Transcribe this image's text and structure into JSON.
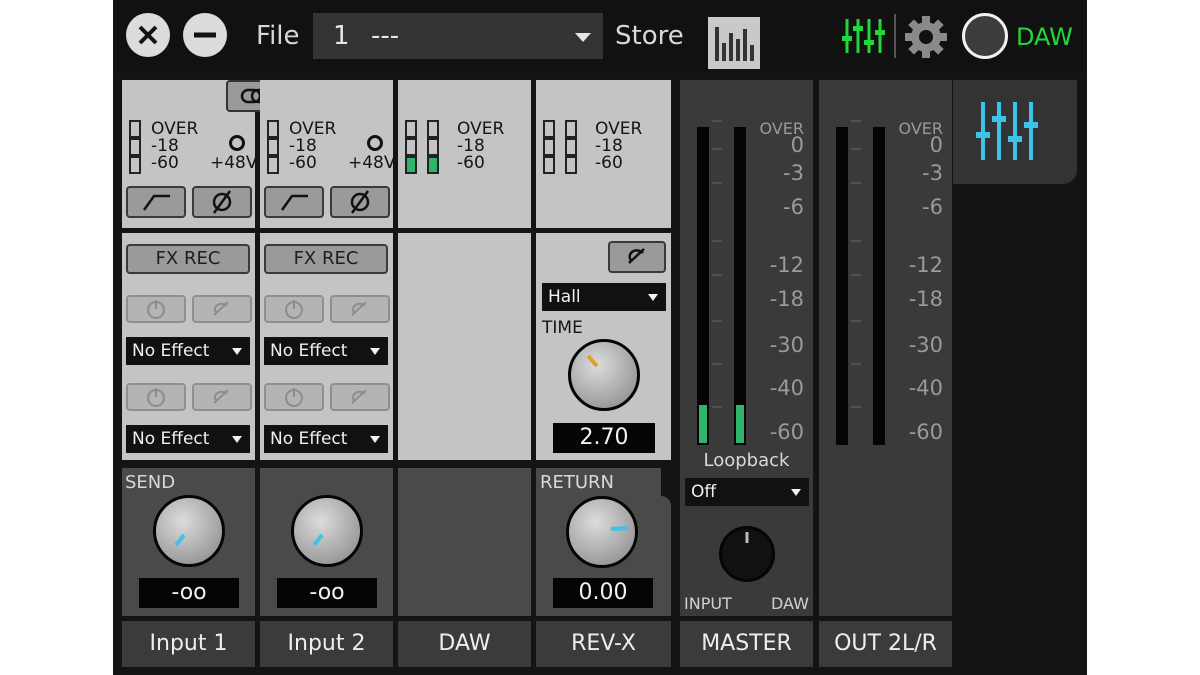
{
  "header": {
    "file_label": "File",
    "file_number": "1",
    "file_name": "---",
    "store_label": "Store",
    "daw_label": "DAW"
  },
  "icons": {
    "close": "close-icon",
    "minimize": "minimize-icon",
    "meter_view": "meter-bars-icon",
    "mixer": "mixer-faders-icon",
    "settings": "gear-icon",
    "daw_indicator": "circle-icon",
    "link": "link-icon",
    "hpf": "high-pass-filter-icon",
    "phase": "phase-invert-icon",
    "edit": "edit-icon",
    "power": "power-icon"
  },
  "colors": {
    "accent_green": "#22d63c",
    "accent_cyan": "#3ec3e8",
    "meter_green": "#2fb56b"
  },
  "meter_labels": {
    "over": "OVER",
    "m18": "-18",
    "m60": "-60",
    "phantom": "+48V"
  },
  "channels": {
    "input1": {
      "label": "Input 1",
      "fx_rec": "FX REC",
      "effect1": "No Effect",
      "effect2": "No Effect",
      "send_label": "SEND",
      "send_value": "-oo"
    },
    "input2": {
      "label": "Input 2",
      "fx_rec": "FX REC",
      "effect1": "No Effect",
      "effect2": "No Effect",
      "send_value": "-oo"
    },
    "daw": {
      "label": "DAW"
    },
    "revx": {
      "label": "REV-X",
      "type": "Hall",
      "time_label": "TIME",
      "time_value": "2.70",
      "return_label": "RETURN",
      "return_value": "0.00"
    },
    "master": {
      "label": "MASTER",
      "loopback_label": "Loopback",
      "loopback_value": "Off",
      "mix_left": "INPUT",
      "mix_right": "DAW"
    },
    "out": {
      "label": "OUT 2L/R"
    }
  },
  "meter_scale": [
    "OVER",
    "0",
    "-3",
    "-6",
    "-12",
    "-18",
    "-30",
    "-40",
    "-60"
  ],
  "levels": {
    "master_left": 0.12,
    "master_right": 0.12,
    "out_left": 0,
    "out_right": 0
  }
}
